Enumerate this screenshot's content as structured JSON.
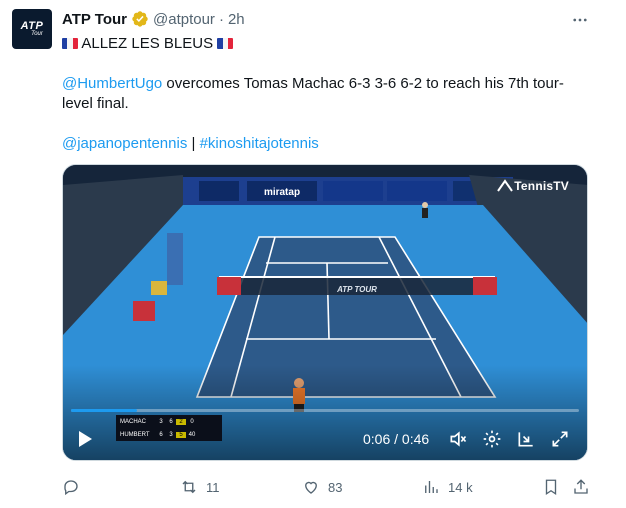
{
  "author": {
    "name": "ATP Tour",
    "handle": "@atptour",
    "separator": "·",
    "time": "2h",
    "avatar_text": "ATP",
    "avatar_subtext": "Tour"
  },
  "tweet": {
    "line1_text": "ALLEZ LES BLEUS",
    "mention": "@HumbertUgo",
    "body_text": " overcomes Tomas Machac 6-3 3-6 6-2 to reach his 7th tour-level final.",
    "hashtag1": "@japanopentennis",
    "divider": " | ",
    "hashtag2": "#kinoshitajotennis"
  },
  "video": {
    "current_time": "0:06",
    "time_separator": " / ",
    "duration": "0:46",
    "progress": 0.13,
    "watermark": "TennisTV",
    "court_brand": "ATP TOUR",
    "banner_text": "miratap",
    "scoreboard": [
      {
        "name": "MACHAC",
        "s1": "3",
        "s2": "6",
        "s3": "2",
        "pts": "0"
      },
      {
        "name": "HUMBERT",
        "s1": "6",
        "s2": "3",
        "s3": "5",
        "pts": "40"
      }
    ]
  },
  "actions": {
    "replies": "",
    "reposts": "11",
    "likes": "83",
    "views": "14 k"
  },
  "colors": {
    "accent": "#1d9bf0",
    "court": "#2d5a8a",
    "surround": "#2f8fd6"
  }
}
